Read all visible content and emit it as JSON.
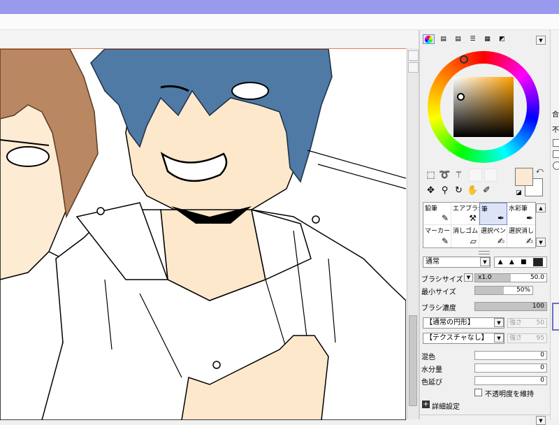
{
  "colors": {
    "titlebar": "#9999ee",
    "selection": "#dde4f7",
    "canvas_border": "#e07f5f"
  },
  "color_panel": {
    "tabs": [
      "color-wheel-icon",
      "slider-icon",
      "slider-icon",
      "list-icon",
      "swatch-icon",
      "palette-icon"
    ],
    "fg_color": "#fde8d2",
    "bg_color": "#ffffff"
  },
  "tools": {
    "row1": [
      "marquee-icon",
      "lasso-icon",
      "magic-wand-icon"
    ],
    "row2": [
      "move-icon",
      "zoom-icon",
      "rotate-icon",
      "hand-icon",
      "eyedropper-icon"
    ]
  },
  "brushes": [
    {
      "label": "鉛筆",
      "icon": "✎"
    },
    {
      "label": "エアブラシ",
      "icon": "✈"
    },
    {
      "label": "筆",
      "icon": "✒"
    },
    {
      "label": "水彩筆",
      "icon": "✒"
    },
    {
      "label": "マーカー",
      "icon": "✎"
    },
    {
      "label": "消しゴム",
      "icon": "▱"
    },
    {
      "label": "選択ペン",
      "icon": "✍"
    },
    {
      "label": "選択消し",
      "icon": "✍"
    }
  ],
  "blend_mode": "通常",
  "brush_size": {
    "label": "ブラシサイズ",
    "multiplier": "x1.0",
    "value": "50.0",
    "fill": 0.5
  },
  "min_size": {
    "label": "最小サイズ",
    "value": "50%",
    "fill": 0.5
  },
  "brush_density": {
    "label": "ブラシ濃度",
    "value": "100",
    "fill": 1.0
  },
  "shape_select": {
    "value": "【通常の円形】",
    "strength_label": "強さ",
    "strength": "50"
  },
  "texture_select": {
    "value": "【テクスチャなし】",
    "strength_label": "強さ",
    "strength": "95"
  },
  "mix": {
    "label": "混色",
    "value": "0"
  },
  "water": {
    "label": "水分量",
    "value": "0"
  },
  "color_stretch": {
    "label": "色延び",
    "value": "0"
  },
  "keep_opacity_label": "不透明度を維持",
  "details_label": "詳細設定",
  "right_edge": {
    "a": "合",
    "b": "不"
  }
}
